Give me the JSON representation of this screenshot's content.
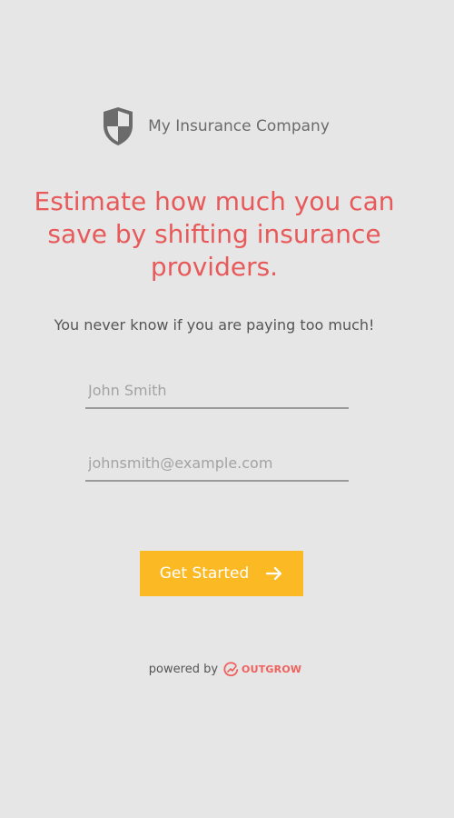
{
  "brand": {
    "name": "My Insurance Company",
    "icon": "shield-icon",
    "icon_color": "#6b6b6b"
  },
  "hero": {
    "headline": "Estimate how much you can save by shifting insurance providers.",
    "headline_color": "#e8595a",
    "subtitle": "You never know if you are paying too much!"
  },
  "form": {
    "name_placeholder": "John Smith",
    "name_value": "",
    "email_placeholder": "johnsmith@example.com",
    "email_value": ""
  },
  "cta": {
    "label": "Get Started",
    "icon": "arrow-right-icon",
    "color": "#fbb924"
  },
  "footer": {
    "powered_label": "powered by",
    "provider": "OUTGROW",
    "provider_icon": "outgrow-logo-icon",
    "provider_color": "#f0605d"
  }
}
